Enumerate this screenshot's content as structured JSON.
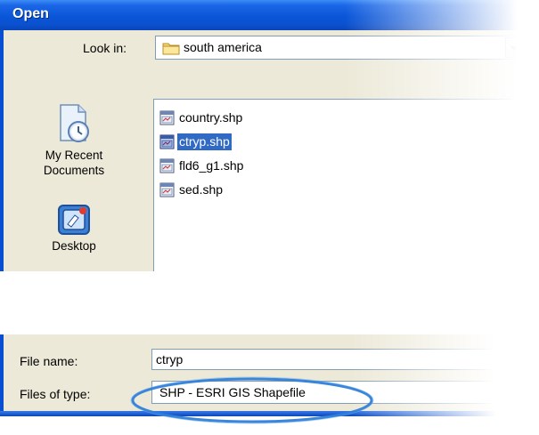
{
  "dialog": {
    "title": "Open",
    "look_in": {
      "label": "Look in:",
      "value": "south america"
    },
    "places": [
      {
        "label": "My Recent\nDocuments",
        "icon": "recent-documents-icon"
      },
      {
        "label": "Desktop",
        "icon": "desktop-icon"
      }
    ],
    "files": [
      {
        "name": "country.shp",
        "icon": "shapefile-icon",
        "selected": false
      },
      {
        "name": "ctryp.shp",
        "icon": "shapefile-icon",
        "selected": true
      },
      {
        "name": "fld6_g1.shp",
        "icon": "shapefile-icon",
        "selected": false
      },
      {
        "name": "sed.shp",
        "icon": "shapefile-icon",
        "selected": false
      }
    ],
    "file_name": {
      "label": "File name:",
      "value": "ctryp"
    },
    "file_type": {
      "label": "Files of type:",
      "value": "SHP - ESRI GIS Shapefile"
    }
  },
  "colors": {
    "title_bar": "#0a56d8",
    "dialog_bg": "#ece9d8",
    "selection": "#316ac5",
    "highlight_ellipse": "#2f7fd9"
  }
}
